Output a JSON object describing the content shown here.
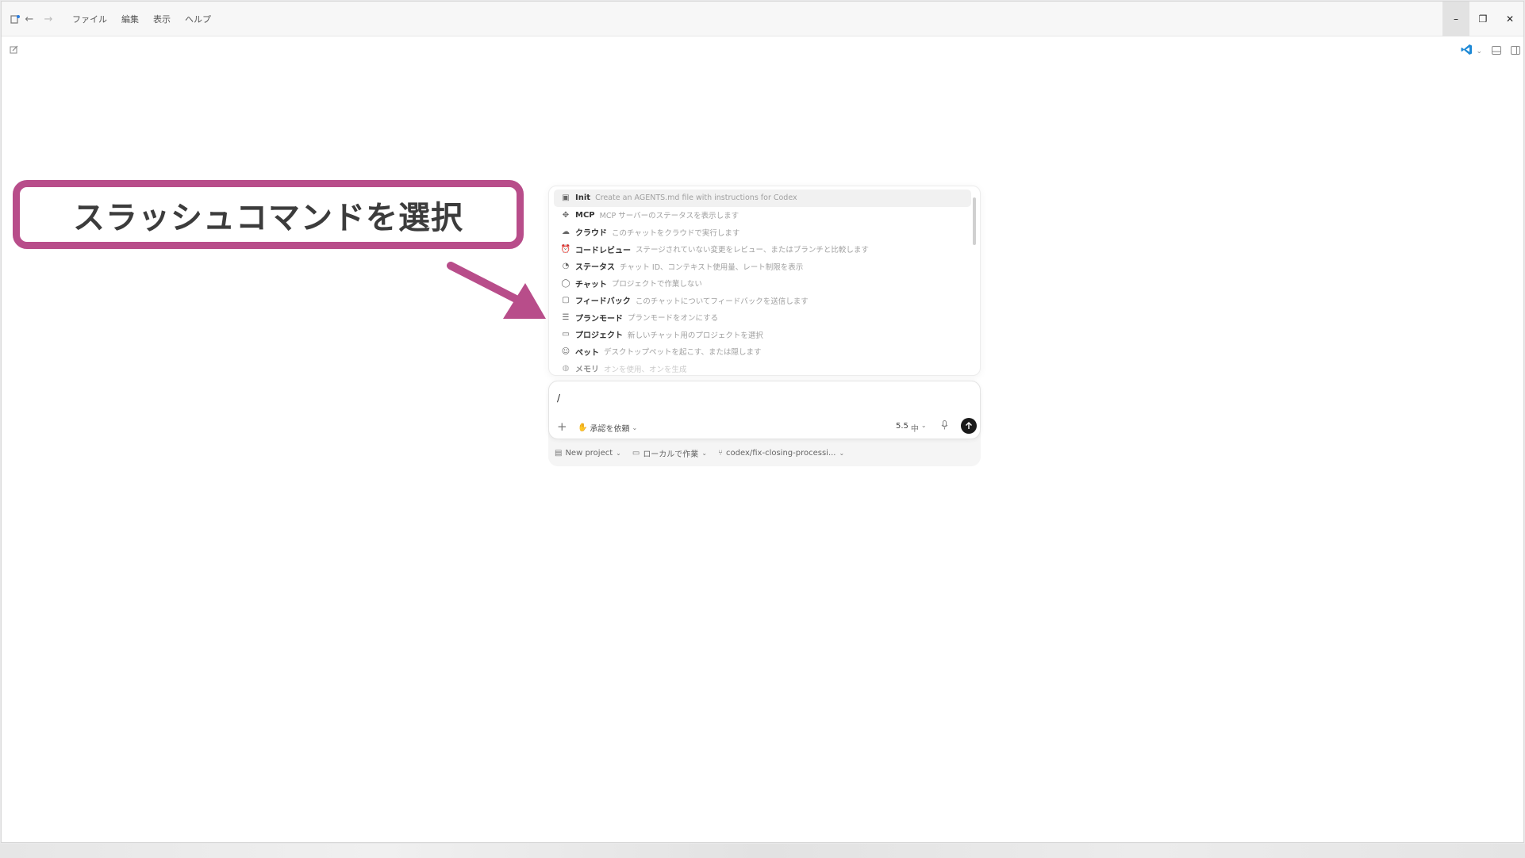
{
  "titlebar": {
    "menu": [
      "ファイル",
      "編集",
      "表示",
      "ヘルプ"
    ],
    "window_controls": {
      "minimize": "–",
      "restore": "❐",
      "close": "✕"
    }
  },
  "command_list": [
    {
      "icon": "file-icon",
      "glyph": "▣",
      "name": "Init",
      "desc": "Create an AGENTS.md file with instructions for Codex",
      "selected": true
    },
    {
      "icon": "mcp-icon",
      "glyph": "✥",
      "name": "MCP",
      "desc": "MCP サーバーのステータスを表示します"
    },
    {
      "icon": "cloud-icon",
      "glyph": "☁",
      "name": "クラウド",
      "desc": "このチャットをクラウドで実行します"
    },
    {
      "icon": "review-icon",
      "glyph": "⏰",
      "name": "コードレビュー",
      "desc": "ステージされていない変更をレビュー、またはブランチと比較します"
    },
    {
      "icon": "gauge-icon",
      "glyph": "◔",
      "name": "ステータス",
      "desc": "チャット ID、コンテキスト使用量、レート制限を表示"
    },
    {
      "icon": "chat-icon",
      "glyph": "◯",
      "name": "チャット",
      "desc": "プロジェクトで作業しない"
    },
    {
      "icon": "feedback-icon",
      "glyph": "▢",
      "name": "フィードバック",
      "desc": "このチャットについてフィードバックを送信します"
    },
    {
      "icon": "plan-icon",
      "glyph": "☰",
      "name": "プランモード",
      "desc": "プランモードをオンにする"
    },
    {
      "icon": "folder-icon",
      "glyph": "▭",
      "name": "プロジェクト",
      "desc": "新しいチャット用のプロジェクトを選択"
    },
    {
      "icon": "pet-icon",
      "glyph": "☺",
      "name": "ペット",
      "desc": "デスクトップペットを起こす、または隠します"
    },
    {
      "icon": "memory-icon",
      "glyph": "◍",
      "name": "メモリ",
      "desc": "オンを使用、オンを生成",
      "faded": true
    }
  ],
  "composer": {
    "input_value": "/",
    "approval_label": "承認を依頼",
    "model_label": "5.5",
    "effort_label": "中"
  },
  "footer": {
    "project": "New project",
    "location": "ローカルで作業",
    "branch": "codex/fix-closing-processi..."
  },
  "annotation": {
    "text": "スラッシュコマンドを選択",
    "color": "#b84d8a"
  }
}
